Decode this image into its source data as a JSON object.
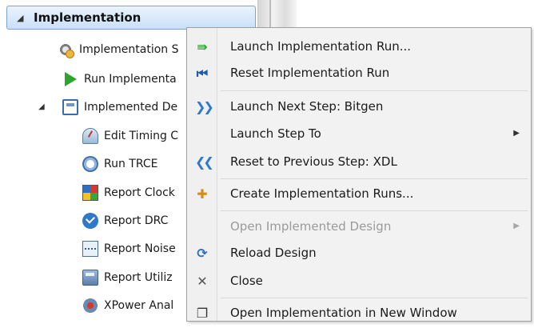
{
  "tree": {
    "header": "Implementation",
    "items": [
      {
        "label": "Implementation S",
        "icon": "implementation-settings-icon"
      },
      {
        "label": "Run Implementa",
        "icon": "run-icon"
      },
      {
        "label": "Implemented De",
        "icon": "implemented-design-icon"
      },
      {
        "label": "Edit Timing C",
        "icon": "edit-timing-icon"
      },
      {
        "label": "Run TRCE",
        "icon": "stopwatch-icon"
      },
      {
        "label": "Report Clock",
        "icon": "report-clock-icon"
      },
      {
        "label": "Report DRC",
        "icon": "checkmark-icon"
      },
      {
        "label": "Report Noise",
        "icon": "report-noise-icon"
      },
      {
        "label": "Report Utiliz",
        "icon": "calculator-icon"
      },
      {
        "label": "XPower Anal",
        "icon": "xpower-icon"
      }
    ]
  },
  "menu": {
    "items": [
      {
        "label": "Launch Implementation Run...",
        "icon": "launch-icon",
        "glyph": "⇛",
        "enabled": true,
        "submenu": false
      },
      {
        "label": "Reset Implementation Run",
        "icon": "reset-icon",
        "glyph": "⏮",
        "enabled": true,
        "submenu": false
      },
      {
        "label": "Launch Next Step: Bitgen",
        "icon": "next-step-icon",
        "glyph": "❯❯",
        "enabled": true,
        "submenu": false
      },
      {
        "label": "Launch Step To",
        "icon": "",
        "glyph": "",
        "enabled": true,
        "submenu": true
      },
      {
        "label": "Reset to Previous Step: XDL",
        "icon": "previous-step-icon",
        "glyph": "❮❮",
        "enabled": true,
        "submenu": false
      },
      {
        "label": "Create Implementation Runs...",
        "icon": "create-runs-icon",
        "glyph": "✚",
        "enabled": true,
        "submenu": false
      },
      {
        "label": "Open Implemented Design",
        "icon": "",
        "glyph": "",
        "enabled": false,
        "submenu": true
      },
      {
        "label": "Reload Design",
        "icon": "reload-icon",
        "glyph": "⟳",
        "enabled": true,
        "submenu": false
      },
      {
        "label": "Close",
        "icon": "close-icon",
        "glyph": "✕",
        "enabled": true,
        "submenu": false
      },
      {
        "label": "Open Implementation in New Window",
        "icon": "new-window-icon",
        "glyph": "❐",
        "enabled": true,
        "submenu": false
      }
    ],
    "submenu_arrow": "▶"
  },
  "colors": {
    "header_gradient_top": "#eaf3fd",
    "header_gradient_bottom": "#c9e0f7",
    "menu_background": "#f2f2f2",
    "disabled_text": "#9a9a9a"
  }
}
